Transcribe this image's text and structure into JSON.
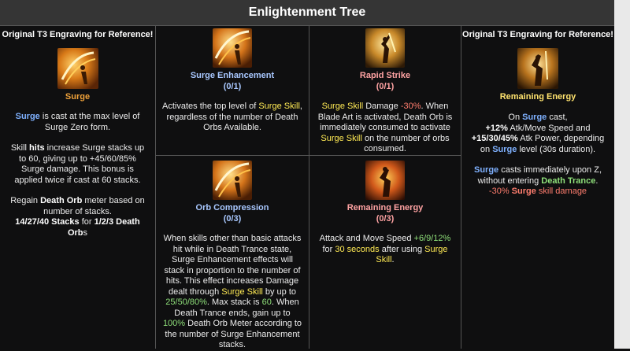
{
  "title": "Enlightenment Tree",
  "left": {
    "header": "Original T3 Engraving for Reference!",
    "icon": "surge-skill-icon",
    "name": "Surge",
    "p1": {
      "a": "Surge",
      "b": " is cast at the max level of Surge Zero form."
    },
    "p2": {
      "a": "Skill ",
      "b": "hits",
      "c": " increase Surge stacks up to 60, giving up to +45/60/85% Surge damage. This bonus is applied twice if cast at 60 stacks."
    },
    "p3": {
      "a": "Regain ",
      "b": "Death Orb",
      "c": " meter based on number of stacks.",
      "d": "14/27/40 Stacks",
      "e": " for ",
      "f": "1/2/3 Death Orb",
      "g": "s"
    }
  },
  "surge_enhancement": {
    "icon": "surge-enhancement-icon",
    "name": "Surge Enhancement",
    "rank": "(0/1)",
    "d1": "Activates the top level of ",
    "d2": "Surge Skill",
    "d3": ", regardless of the number of Death Orbs Available."
  },
  "rapid_strike": {
    "icon": "rapid-strike-icon",
    "name": "Rapid Strike",
    "rank": "(0/1)",
    "d1": "Surge Skill",
    "d2": " Damage ",
    "d3": "-30%",
    "d4": ". When Blade Art is activated, Death Orb is immediately consumed to activate ",
    "d5": "Surge Skill",
    "d6": " on the number of orbs consumed."
  },
  "orb_compression": {
    "icon": "orb-compression-icon",
    "name": "Orb Compression",
    "rank": "(0/3)",
    "d1": "When skills other than basic attacks hit while in Death Trance state, Surge Enhancement effects will stack in proportion to the number of hits. This effect increases Damage dealt through ",
    "d2": "Surge Skill",
    "d3": " by up to ",
    "d4": "25/50/80%",
    "d5": ". Max stack is ",
    "d6": "60",
    "d7": ". When Death Trance ends, gain up to ",
    "d8": "100%",
    "d9": " Death Orb Meter according to the number of Surge Enhancement stacks."
  },
  "remaining_energy_node": {
    "icon": "remaining-energy-icon",
    "name": "Remaining Energy",
    "rank": "(0/3)",
    "d1": "Attack and Move Speed ",
    "d2": "+6/9/12%",
    "d3": " for ",
    "d4": "30 seconds",
    "d5": " after using ",
    "d6": "Surge Skill",
    "d7": "."
  },
  "right": {
    "header": "Original T3 Engraving for Reference!",
    "icon": "remaining-energy-engraving-icon",
    "name": "Remaining Energy",
    "p1": {
      "a": "On ",
      "b": "Surge",
      "c": " cast,",
      "d": "+12%",
      "e": " Atk/Move Speed and ",
      "f": "+15/30/45%",
      "g": " Atk Power, depending on ",
      "h": "Surge",
      "i": " level (30s duration)."
    },
    "p2": {
      "a": "Surge",
      "b": " casts immediately upon Z, without entering ",
      "c": "Death Trance",
      "d": ".",
      "e": "-30% ",
      "f": "Surge",
      "g": " skill damage"
    }
  },
  "colors": {
    "skill_orange": "#f0a23a",
    "skill_blue": "#a9c8ff",
    "skill_pink": "#ffa3a3",
    "highlight_yellow": "#ffea54",
    "highlight_green": "#8fe07a",
    "penalty_red": "#ff7d6e"
  }
}
